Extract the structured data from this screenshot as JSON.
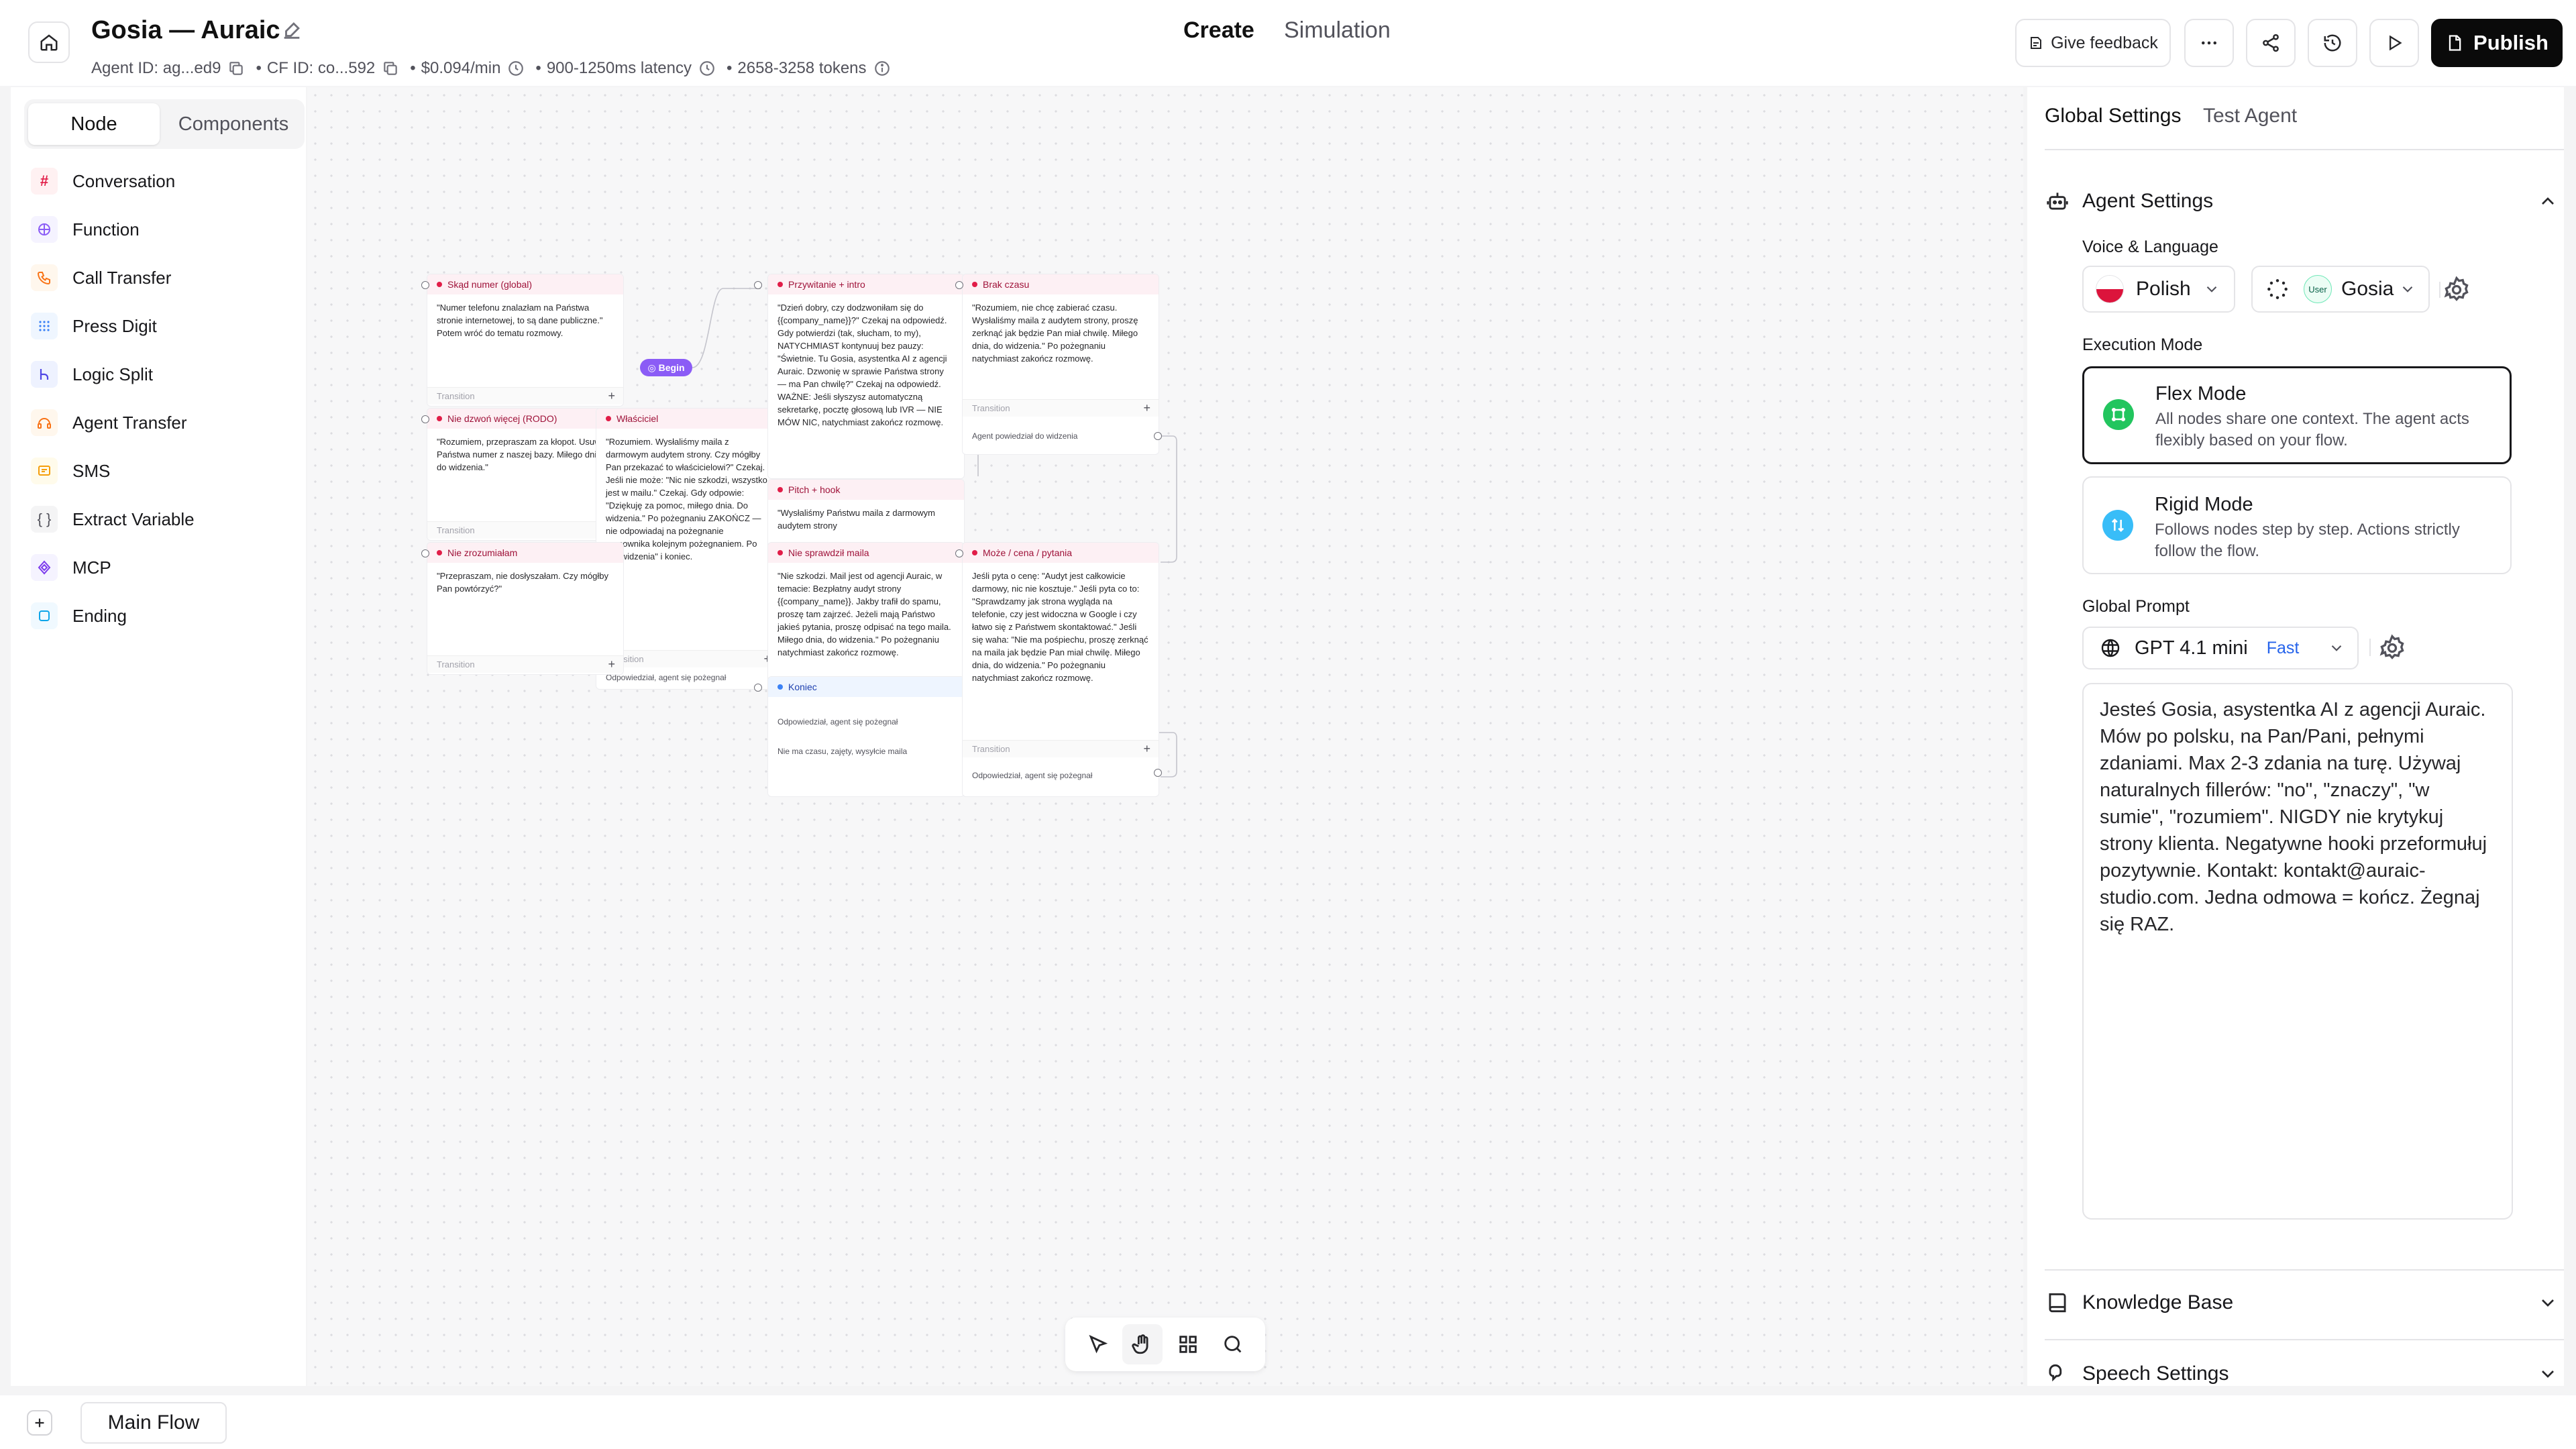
{
  "header": {
    "agent_name": "Gosia — Auraic",
    "agent_id": "Agent ID: ag...ed9",
    "cf_id": "CF ID: co...592",
    "cost": "$0.094/min",
    "latency": "900-1250ms latency",
    "tokens": "2658-3258 tokens",
    "tabs": {
      "create": "Create",
      "simulation": "Simulation"
    },
    "feedback_label": "Give feedback",
    "publish_label": "Publish"
  },
  "left_panel": {
    "tabs": {
      "node": "Node",
      "components": "Components"
    },
    "items": [
      {
        "label": "Conversation",
        "icon": "hash-icon",
        "color": "#e11d48"
      },
      {
        "label": "Function",
        "icon": "function-icon",
        "color": "#8b5cf6"
      },
      {
        "label": "Call Transfer",
        "icon": "phone-icon",
        "color": "#f97316"
      },
      {
        "label": "Press Digit",
        "icon": "keypad-icon",
        "color": "#3b82f6"
      },
      {
        "label": "Logic Split",
        "icon": "split-icon",
        "color": "#4f46e5"
      },
      {
        "label": "Agent Transfer",
        "icon": "agent-transfer-icon",
        "color": "#f97316"
      },
      {
        "label": "SMS",
        "icon": "sms-icon",
        "color": "#f59e0b"
      },
      {
        "label": "Extract Variable",
        "icon": "braces-icon",
        "color": "#52525b"
      },
      {
        "label": "MCP",
        "icon": "mcp-icon",
        "color": "#7c3aed"
      },
      {
        "label": "Ending",
        "icon": "ending-icon",
        "color": "#0ea5e9"
      }
    ]
  },
  "canvas": {
    "begin_label": "Begin",
    "nodes": [
      {
        "title": "Skąd numer (global)",
        "text": "\"Numer telefonu znalazłam na Państwa stronie internetowej, to są dane publiczne.\" Potem wróć do tematu rozmowy.",
        "transition": "Transition"
      },
      {
        "title": "Nie dzwoń więcej (RODO)",
        "text": "\"Rozumiem, przepraszam za kłopot. Usuwam Państwa numer z naszej bazy. Miłego dnia, do widzenia.\"",
        "transition": "Transition"
      },
      {
        "title": "Nie zrozumiałam",
        "text": "\"Przepraszam, nie dosłyszałam. Czy mógłby Pan powtórzyć?\"",
        "transition": "Transition"
      },
      {
        "title": "Przywitanie + intro",
        "text": "\"Dzień dobry, czy dodzwoniłam się do {{company_name}}?\" Czekaj na odpowiedź. Gdy potwierdzi (tak, słucham, to my), NATYCHMIAST kontynuuj bez pauzy: \"Świetnie. Tu Gosia, asystentka AI z agencji Auraic. Dzwonię w sprawie Państwa strony — ma Pan chwilę?\" Czekaj na odpowiedź. WAŻNE: Jeśli słyszysz automatyczną sekretarkę, pocztę głosową lub IVR — NIE MÓW NIC, natychmiast zakończ rozmowę."
      },
      {
        "title": "Brak czasu",
        "text": "\"Rozumiem, nie chcę zabierać czasu. Wysłaliśmy maila z audytem strony, proszę zerknąć jak będzie Pan miał chwilę. Miłego dnia, do widzenia.\" Po pożegnaniu natychmiast zakończ rozmowę.",
        "transition": "Transition",
        "edge": "Agent powiedział do widzenia"
      },
      {
        "title": "Właściciel",
        "text": "\"Rozumiem. Wysłaliśmy maila z darmowym audytem strony. Czy mógłby Pan przekazać to właścicielowi?\" Czekaj. Jeśli nie może: \"Nic nie szkodzi, wszystko jest w mailu.\" Czekaj. Gdy odpowie: \"Dziękuję za pomoc, miłego dnia. Do widzenia.\" Po pożegnaniu ZAKOŃCZ — nie odpowiadaj na pożegnanie pracownika kolejnym pożegnaniem. Po \"do widzenia\" i koniec.",
        "transition": "Transition",
        "edge": "Odpowiedział, agent się pożegnał"
      },
      {
        "title": "Pitch + hook",
        "text": "\"Wysłaliśmy Państwu maila z darmowym audytem strony"
      },
      {
        "title": "Może / cena / pytania",
        "text": "Jeśli pyta o cenę: \"Audyt jest całkowicie darmowy, nic nie kosztuje.\" Jeśli pyta co to: \"Sprawdzamy jak strona wygląda na telefonie, czy jest widoczna w Google i czy łatwo się z Państwem skontaktować.\" Jeśli się waha: \"Nie ma pośpiechu, proszę zerknąć na maila jak będzie Pan miał chwilę. Miłego dnia, do widzenia.\" Po pożegnaniu natychmiast zakończ rozmowę.",
        "transition": "Transition",
        "edge": "Odpowiedział, agent się pożegnał"
      },
      {
        "title": "Nie sprawdził maila",
        "text": "\"Nie szkodzi. Mail jest od agencji Auraic, w temacie: Bezpłatny audyt strony {{company_name}}. Jakby trafił do spamu, proszę tam zajrzeć. Jeżeli mają Państwo jakieś pytania, proszę odpisać na tego maila. Miłego dnia, do widzenia.\" Po pożegnaniu natychmiast zakończ rozmowę.",
        "transition": "Transition",
        "edge": "Odpowiedział, agent się pożegnał"
      },
      {
        "title": "Koniec",
        "edge1": "Odpowiedział, agent się pożegnał",
        "edge2": "Nie ma czasu, zajęty, wysyłcie maila"
      }
    ]
  },
  "right_panel": {
    "tabs": {
      "global": "Global Settings",
      "test": "Test Agent"
    },
    "agent_settings": {
      "title": "Agent Settings",
      "voice_label": "Voice & Language",
      "language": "Polish",
      "voice": "Gosia",
      "voice_badge": "User",
      "execution_label": "Execution Mode",
      "flex_title": "Flex Mode",
      "flex_desc": "All nodes share one context. The agent acts flexibly based on your flow.",
      "rigid_title": "Rigid Mode",
      "rigid_desc": "Follows nodes step by step. Actions strictly follow the flow.",
      "prompt_label": "Global Prompt",
      "model": "GPT 4.1 mini",
      "model_tag": "Fast",
      "prompt_text": "Jesteś Gosia, asystentka AI z agencji Auraic. Mów po polsku, na Pan/Pani, pełnymi zdaniami. Max 2-3 zdania na turę. Używaj naturalnych fillerów: \"no\", \"znaczy\", \"w sumie\", \"rozumiem\". NIGDY nie krytykuj strony klienta. Negatywne hooki przeformułuj pozytywnie. Kontakt: kontakt@auraic-studio.com. Jedna odmowa = kończ. Żegnaj się RAZ."
    },
    "knowledge_base": "Knowledge Base",
    "speech_settings": "Speech Settings"
  },
  "bottom": {
    "flow_tab": "Main Flow"
  },
  "colors": {
    "accent": "#e11d48",
    "publish_bg": "#0a0a0a",
    "begin": "#8b5cf6",
    "flex_icon": "#22c55e",
    "rigid_icon": "#38bdf8"
  }
}
